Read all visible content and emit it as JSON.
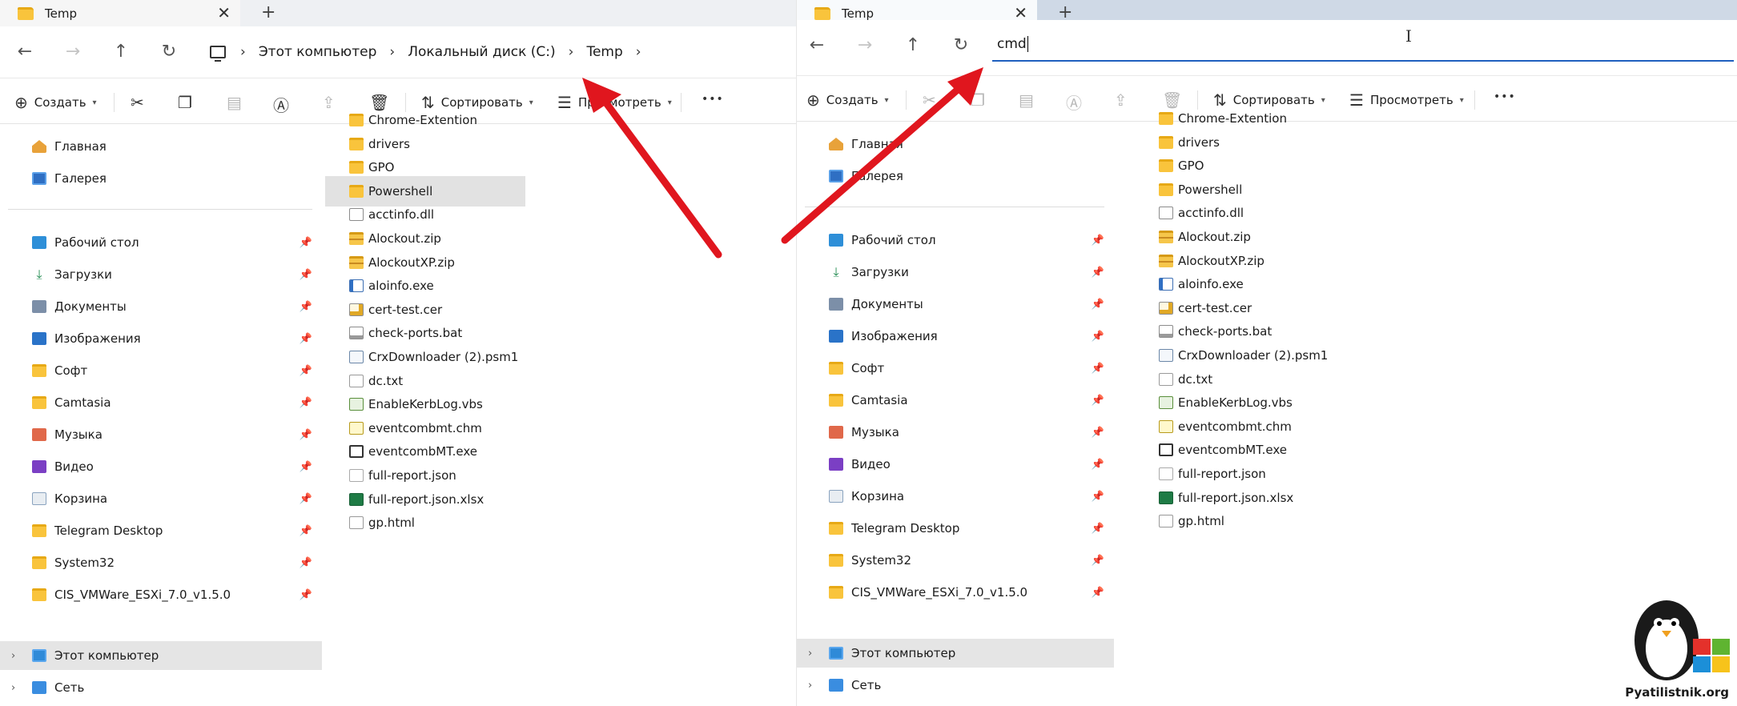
{
  "left": {
    "tab": {
      "title": "Temp",
      "close": "✕",
      "new": "+"
    },
    "nav": {
      "back": "←",
      "forward": "→",
      "up": "↑",
      "refresh": "↻"
    },
    "breadcrumb": [
      "Этот компьютер",
      "Локальный диск (C:)",
      "Temp"
    ],
    "toolbar": {
      "create": "Создать",
      "sort": "Сортировать",
      "view": "Просмотреть",
      "more": "•••"
    },
    "sidebar": {
      "top": [
        {
          "label": "Главная",
          "icon": "home-icon"
        },
        {
          "label": "Галерея",
          "icon": "gallery-icon"
        }
      ],
      "quick": [
        {
          "label": "Рабочий стол",
          "icon": "desktop-icon"
        },
        {
          "label": "Загрузки",
          "icon": "download-icon"
        },
        {
          "label": "Документы",
          "icon": "documents-icon"
        },
        {
          "label": "Изображения",
          "icon": "images-icon"
        },
        {
          "label": "Софт",
          "icon": "folder-icon"
        },
        {
          "label": "Camtasia",
          "icon": "folder-icon"
        },
        {
          "label": "Музыка",
          "icon": "music-icon"
        },
        {
          "label": "Видео",
          "icon": "video-icon"
        },
        {
          "label": "Корзина",
          "icon": "recycle-bin-icon"
        },
        {
          "label": "Telegram Desktop",
          "icon": "folder-icon"
        },
        {
          "label": "System32",
          "icon": "folder-icon"
        },
        {
          "label": "CIS_VMWare_ESXi_7.0_v1.5.0",
          "icon": "folder-icon"
        }
      ],
      "bottom": [
        {
          "label": "Этот компьютер",
          "icon": "computer-icon"
        },
        {
          "label": "Сеть",
          "icon": "network-icon"
        }
      ]
    },
    "files": [
      {
        "name": "Chrome-Extention",
        "type": "folder"
      },
      {
        "name": "drivers",
        "type": "folder"
      },
      {
        "name": "GPO",
        "type": "folder"
      },
      {
        "name": "Powershell",
        "type": "folder"
      },
      {
        "name": "acctinfo.dll",
        "type": "dll"
      },
      {
        "name": "Alockout.zip",
        "type": "zip"
      },
      {
        "name": "AlockoutXP.zip",
        "type": "zip"
      },
      {
        "name": "aloinfo.exe",
        "type": "exe"
      },
      {
        "name": "cert-test.cer",
        "type": "cer"
      },
      {
        "name": "check-ports.bat",
        "type": "bat"
      },
      {
        "name": "CrxDownloader (2).psm1",
        "type": "psm"
      },
      {
        "name": "dc.txt",
        "type": "txt"
      },
      {
        "name": "EnableKerbLog.vbs",
        "type": "vbs"
      },
      {
        "name": "eventcombmt.chm",
        "type": "chm"
      },
      {
        "name": "eventcombMT.exe",
        "type": "mtexe"
      },
      {
        "name": "full-report.json",
        "type": "json"
      },
      {
        "name": "full-report.json.xlsx",
        "type": "xlsx"
      },
      {
        "name": "gp.html",
        "type": "html"
      }
    ]
  },
  "right": {
    "tab": {
      "title": "Temp",
      "close": "✕",
      "new": "+"
    },
    "nav": {
      "back": "←",
      "forward": "→",
      "up": "↑",
      "refresh": "↻"
    },
    "address": {
      "value": "cmd"
    },
    "toolbar": {
      "create": "Создать",
      "sort": "Сортировать",
      "view": "Просмотреть",
      "more": "•••"
    }
  },
  "colors": {
    "arrow": "#e0161e",
    "accent": "#1f5fbf",
    "selection": "#e2e2e2"
  },
  "watermark": {
    "text": "Pyatilistnik.org"
  }
}
